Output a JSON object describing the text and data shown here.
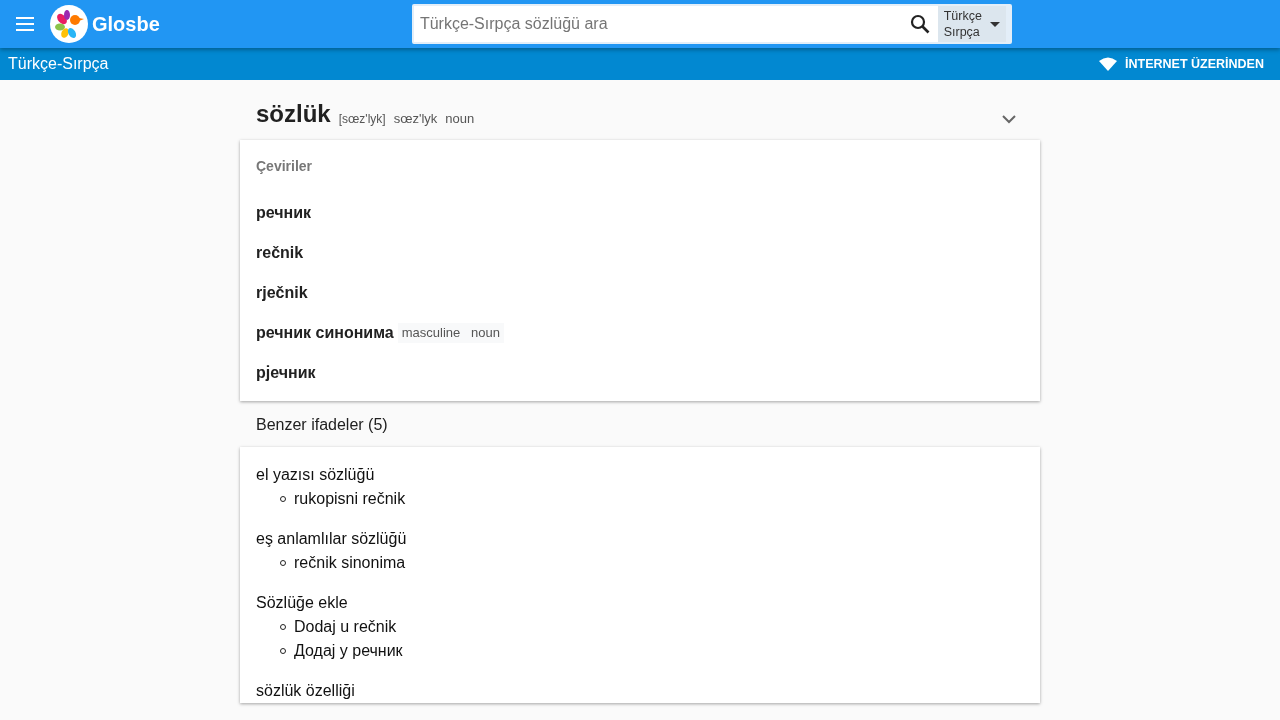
{
  "header": {
    "logo_text": "Glosbe",
    "search": {
      "placeholder": "Türkçe-Sırpça sözlüğü ara"
    },
    "language_select": [
      "Türkçe",
      "Sırpça"
    ]
  },
  "subheader": {
    "title": "Türkçe-Sırpça",
    "mode_button": "İNTERNET ÜZERİNDEN"
  },
  "entry": {
    "word": "sözlük",
    "transcription": "[sœz'lyk]",
    "pronunciation": "sœz'lyk",
    "part_of_speech": "noun",
    "expanded": false
  },
  "translations": {
    "heading": "Çeviriler",
    "items": [
      {
        "text": "речник"
      },
      {
        "text": "rečnik"
      },
      {
        "text": "rječnik"
      },
      {
        "text": "речник синонима",
        "tags": [
          "masculine",
          "noun"
        ]
      },
      {
        "text": "рјечник"
      }
    ]
  },
  "similar": {
    "heading": "Benzer ifadeler (5)",
    "groups": [
      {
        "phrase": "el yazısı sözlüğü",
        "translations": [
          "rukopisni rečnik"
        ]
      },
      {
        "phrase": "eş anlamlılar sözlüğü",
        "translations": [
          "rečnik sinonima"
        ]
      },
      {
        "phrase": "Sözlüğe ekle",
        "translations": [
          "Dodaj u rečnik",
          "Додај у речник"
        ]
      },
      {
        "phrase": "sözlük özelliği"
      }
    ]
  }
}
